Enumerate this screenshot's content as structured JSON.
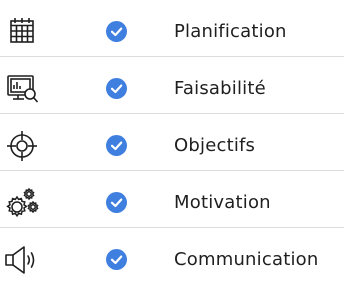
{
  "items": [
    {
      "label": "Planification",
      "icon": "calendar-icon",
      "checked": true
    },
    {
      "label": "Faisabilité",
      "icon": "monitor-chart-search-icon",
      "checked": true
    },
    {
      "label": "Objectifs",
      "icon": "target-icon",
      "checked": true
    },
    {
      "label": "Motivation",
      "icon": "gears-icon",
      "checked": true
    },
    {
      "label": "Communication",
      "icon": "megaphone-icon",
      "checked": true
    }
  ],
  "colors": {
    "accent": "#3f7fe0",
    "icon_stroke": "#1f1f1f",
    "text": "#1f1f1f",
    "divider": "#dcdcdc"
  }
}
